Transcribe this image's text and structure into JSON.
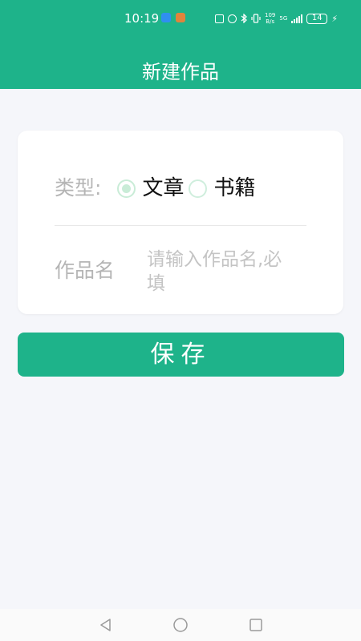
{
  "status_bar": {
    "time": "10:19",
    "net_speed_top": "109",
    "net_speed_bottom": "B/s",
    "network": "5G",
    "battery": "14"
  },
  "header": {
    "title": "新建作品"
  },
  "form": {
    "type_label": "类型:",
    "type_options": [
      {
        "label": "文章",
        "selected": true
      },
      {
        "label": "书籍",
        "selected": false
      }
    ],
    "name_label": "作品名",
    "name_placeholder": "请输入作品名,必填",
    "name_value": ""
  },
  "actions": {
    "save_label": "保存"
  },
  "colors": {
    "primary": "#1eb38a",
    "background": "#f5f6fa",
    "radio": "#c9ecd7",
    "label": "#b5b5b5"
  },
  "icons": {
    "nav_back": "triangle-back-icon",
    "nav_home": "circle-home-icon",
    "nav_recent": "square-recent-icon"
  }
}
